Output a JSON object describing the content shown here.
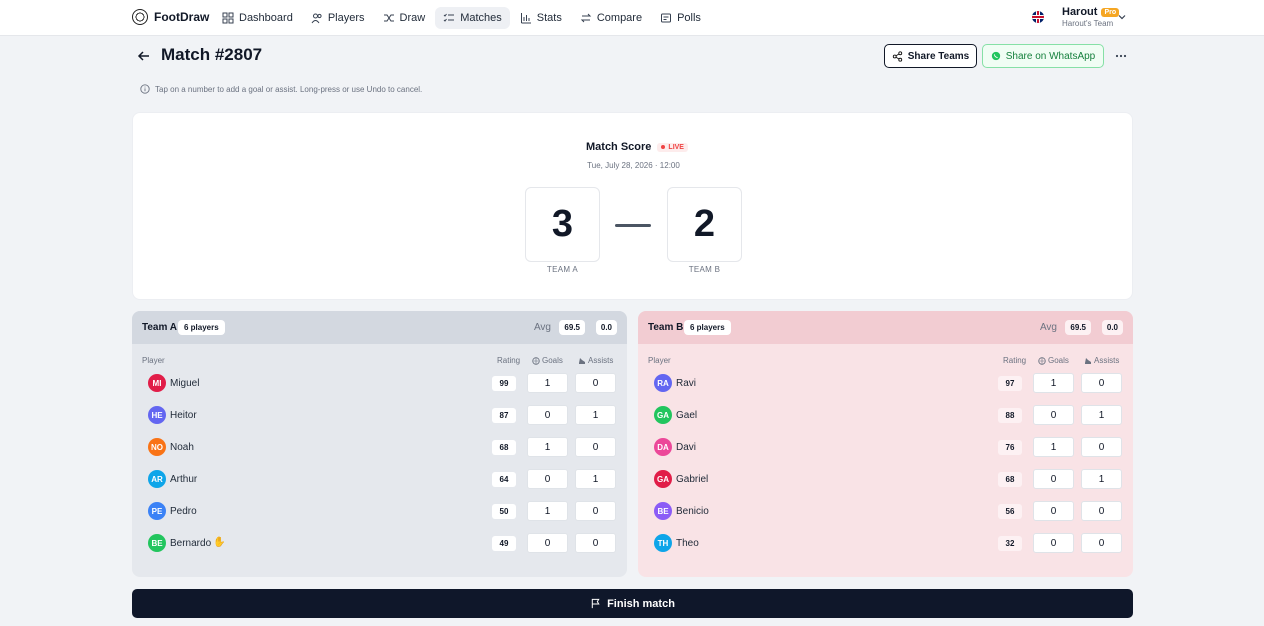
{
  "app": {
    "brand": "FootDraw"
  },
  "nav": [
    {
      "label": "Dashboard",
      "icon": "grid-icon",
      "active": false
    },
    {
      "label": "Players",
      "icon": "users-icon",
      "active": false
    },
    {
      "label": "Draw",
      "icon": "shuffle-icon",
      "active": false
    },
    {
      "label": "Matches",
      "icon": "list-icon",
      "active": true
    },
    {
      "label": "Stats",
      "icon": "bar-chart-icon",
      "active": false
    },
    {
      "label": "Compare",
      "icon": "compare-icon",
      "active": false
    },
    {
      "label": "Polls",
      "icon": "poll-icon",
      "active": false
    }
  ],
  "user": {
    "name": "Harout",
    "badge": "Pro",
    "team": "Harout's Team"
  },
  "header": {
    "title": "Match #2807",
    "share_teams": "Share Teams",
    "share_whatsapp": "Share on WhatsApp"
  },
  "hint": "Tap on a number to add a goal or assist. Long-press or use Undo to cancel.",
  "score": {
    "title": "Match Score",
    "live": "LIVE",
    "date": "Tue, July 28, 2026 · 12:00",
    "team_a": {
      "score": "3",
      "label": "TEAM A"
    },
    "team_b": {
      "score": "2",
      "label": "TEAM B"
    }
  },
  "columns": {
    "player": "Player",
    "rating": "Rating",
    "goals": "Goals",
    "assists": "Assists"
  },
  "team_a": {
    "name": "Team A",
    "count": "6 players",
    "avg_label": "Avg",
    "avg": "69.5",
    "avg2": "0.0",
    "players": [
      {
        "initials": "MI",
        "name": "Miguel",
        "rating": "99",
        "goals": "1",
        "assists": "0",
        "color": "#e11d48"
      },
      {
        "initials": "HE",
        "name": "Heitor",
        "rating": "87",
        "goals": "0",
        "assists": "1",
        "color": "#6366f1"
      },
      {
        "initials": "NO",
        "name": "Noah",
        "rating": "68",
        "goals": "1",
        "assists": "0",
        "color": "#f97316"
      },
      {
        "initials": "AR",
        "name": "Arthur",
        "rating": "64",
        "goals": "0",
        "assists": "1",
        "color": "#0ea5e9"
      },
      {
        "initials": "PE",
        "name": "Pedro",
        "rating": "50",
        "goals": "1",
        "assists": "0",
        "color": "#3b82f6"
      },
      {
        "initials": "BE",
        "name": "Bernardo",
        "rating": "49",
        "goals": "0",
        "assists": "0",
        "color": "#22c55e",
        "goalkeeper": true
      }
    ]
  },
  "team_b": {
    "name": "Team B",
    "count": "6 players",
    "avg_label": "Avg",
    "avg": "69.5",
    "avg2": "0.0",
    "players": [
      {
        "initials": "RA",
        "name": "Ravi",
        "rating": "97",
        "goals": "1",
        "assists": "0",
        "color": "#6366f1"
      },
      {
        "initials": "GA",
        "name": "Gael",
        "rating": "88",
        "goals": "0",
        "assists": "1",
        "color": "#22c55e"
      },
      {
        "initials": "DA",
        "name": "Davi",
        "rating": "76",
        "goals": "1",
        "assists": "0",
        "color": "#ec4899"
      },
      {
        "initials": "GA",
        "name": "Gabriel",
        "rating": "68",
        "goals": "0",
        "assists": "1",
        "color": "#e11d48"
      },
      {
        "initials": "BE",
        "name": "Benicio",
        "rating": "56",
        "goals": "0",
        "assists": "0",
        "color": "#8b5cf6"
      },
      {
        "initials": "TH",
        "name": "Theo",
        "rating": "32",
        "goals": "0",
        "assists": "0",
        "color": "#0ea5e9"
      }
    ]
  },
  "finish": "Finish match"
}
